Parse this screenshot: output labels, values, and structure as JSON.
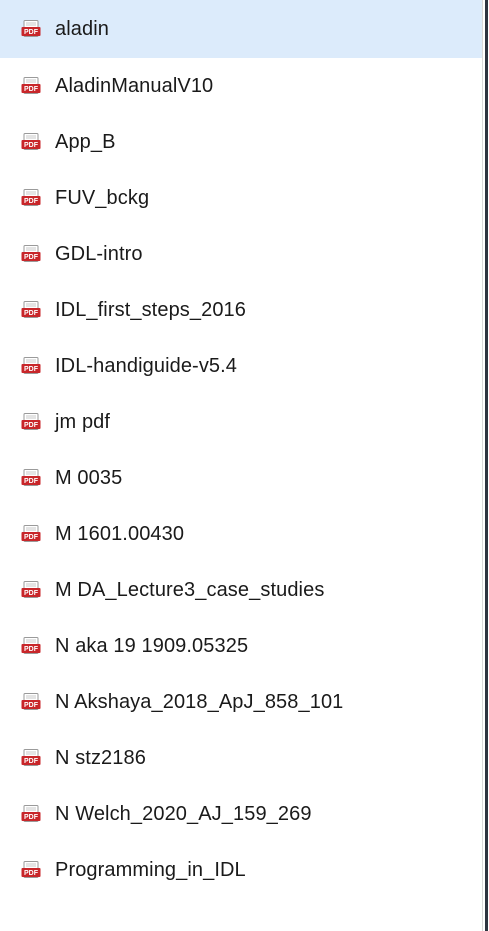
{
  "files": [
    {
      "name": "aladin",
      "selected": true
    },
    {
      "name": "AladinManualV10"
    },
    {
      "name": "App_B"
    },
    {
      "name": "FUV_bckg"
    },
    {
      "name": "GDL-intro"
    },
    {
      "name": "IDL_first_steps_2016"
    },
    {
      "name": "IDL-handiguide-v5.4"
    },
    {
      "name": "jm pdf"
    },
    {
      "name": "M 0035"
    },
    {
      "name": "M 1601.00430"
    },
    {
      "name": "M DA_Lecture3_case_studies"
    },
    {
      "name": "N aka 19 1909.05325"
    },
    {
      "name": "N Akshaya_2018_ApJ_858_101"
    },
    {
      "name": "N stz2186"
    },
    {
      "name": "N Welch_2020_AJ_159_269"
    },
    {
      "name": "Programming_in_IDL"
    }
  ],
  "icon": {
    "name": "pdf-file-icon",
    "text": "PDF",
    "color": "#c8262a"
  },
  "colors": {
    "selected_row": "#dcebfb",
    "text": "#1a1a1a"
  }
}
